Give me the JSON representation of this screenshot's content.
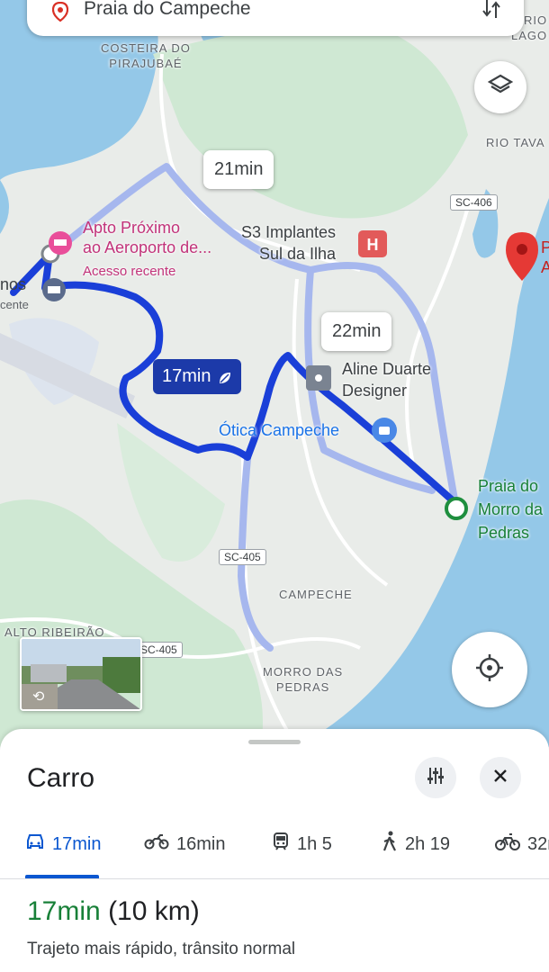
{
  "search": {
    "destination": "Praia do Campeche"
  },
  "map": {
    "places": {
      "costeira": "COSTEIRA DO\nPIRAJUBAÉ",
      "rio_tavares": "RIO TAVA",
      "lagoa": "RIO\nLAGO",
      "campeche": "CAMPECHE",
      "alto_ribeirao": "ALTO RIBEIRÃO",
      "morro_das_pedras": "MORRO DAS\nPEDRAS"
    },
    "pois": {
      "apto_title": "Apto Próximo\nao Aeroporto de...",
      "apto_sub": "Acesso recente",
      "left_cut_1": "nos",
      "left_cut_2": "cente",
      "s3": "S3 Implantes\nSul da Ilha",
      "aline": "Aline Duarte\nDesigner",
      "otica": "Ótica Campeche",
      "praia_morro": "Praia do\nMorro da\nPedras",
      "right_cut": "P\nA"
    },
    "shields": {
      "sc406": "SC-406",
      "sc405_a": "SC-405",
      "sc405_b": "SC-405"
    },
    "callouts": {
      "alt1": "21min",
      "alt2": "22min",
      "selected": "17min"
    },
    "colors": {
      "route": "#1a3fd8",
      "alt_route": "#a6b7ee",
      "water": "#94c8e8",
      "land": "#e9ece9",
      "green": "#cfe8d3",
      "pin": "#e53935"
    }
  },
  "sheet": {
    "title": "Carro",
    "tabs": [
      {
        "mode": "car",
        "icon": "car-icon",
        "label": "17min"
      },
      {
        "mode": "motorcycle",
        "icon": "motorcycle-icon",
        "label": "16min"
      },
      {
        "mode": "transit",
        "icon": "train-icon",
        "label": "1h 5"
      },
      {
        "mode": "walk",
        "icon": "walk-icon",
        "label": "2h 19"
      },
      {
        "mode": "bike",
        "icon": "bike-icon",
        "label": "32r"
      }
    ],
    "summary_duration": "17min",
    "summary_distance": "(10 km)",
    "description": "Trajeto mais rápido, trânsito normal"
  }
}
